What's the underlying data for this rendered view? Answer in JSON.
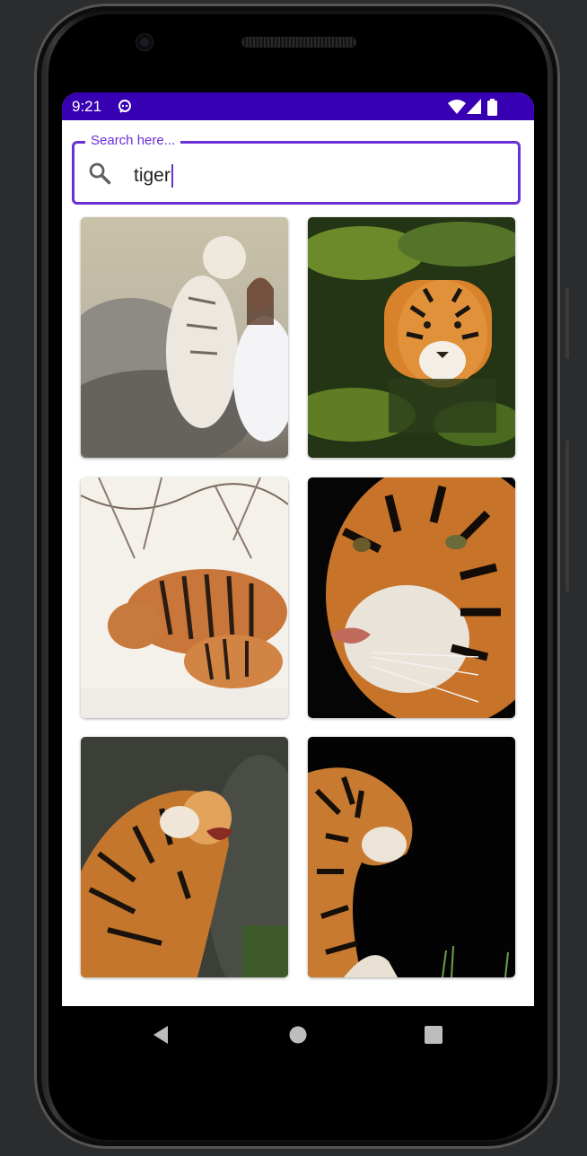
{
  "status_bar": {
    "time": "9:21",
    "background_color": "#3700b3",
    "icons": [
      "notification-icon",
      "wifi-icon",
      "cell-signal-icon",
      "battery-icon"
    ]
  },
  "search": {
    "label": "Search here...",
    "value": "tiger",
    "icon": "search-icon",
    "accent_color": "#6a2fd6"
  },
  "results": {
    "count": 6,
    "images": [
      {
        "subject": "white-tiger-with-woman"
      },
      {
        "subject": "tiger-in-water"
      },
      {
        "subject": "tigress-with-cub-in-snow"
      },
      {
        "subject": "tiger-face-closeup"
      },
      {
        "subject": "roaring-tiger"
      },
      {
        "subject": "tiger-profile-dark-background"
      }
    ]
  },
  "nav_bar": {
    "buttons": [
      "back-button",
      "home-button",
      "recents-button"
    ]
  }
}
